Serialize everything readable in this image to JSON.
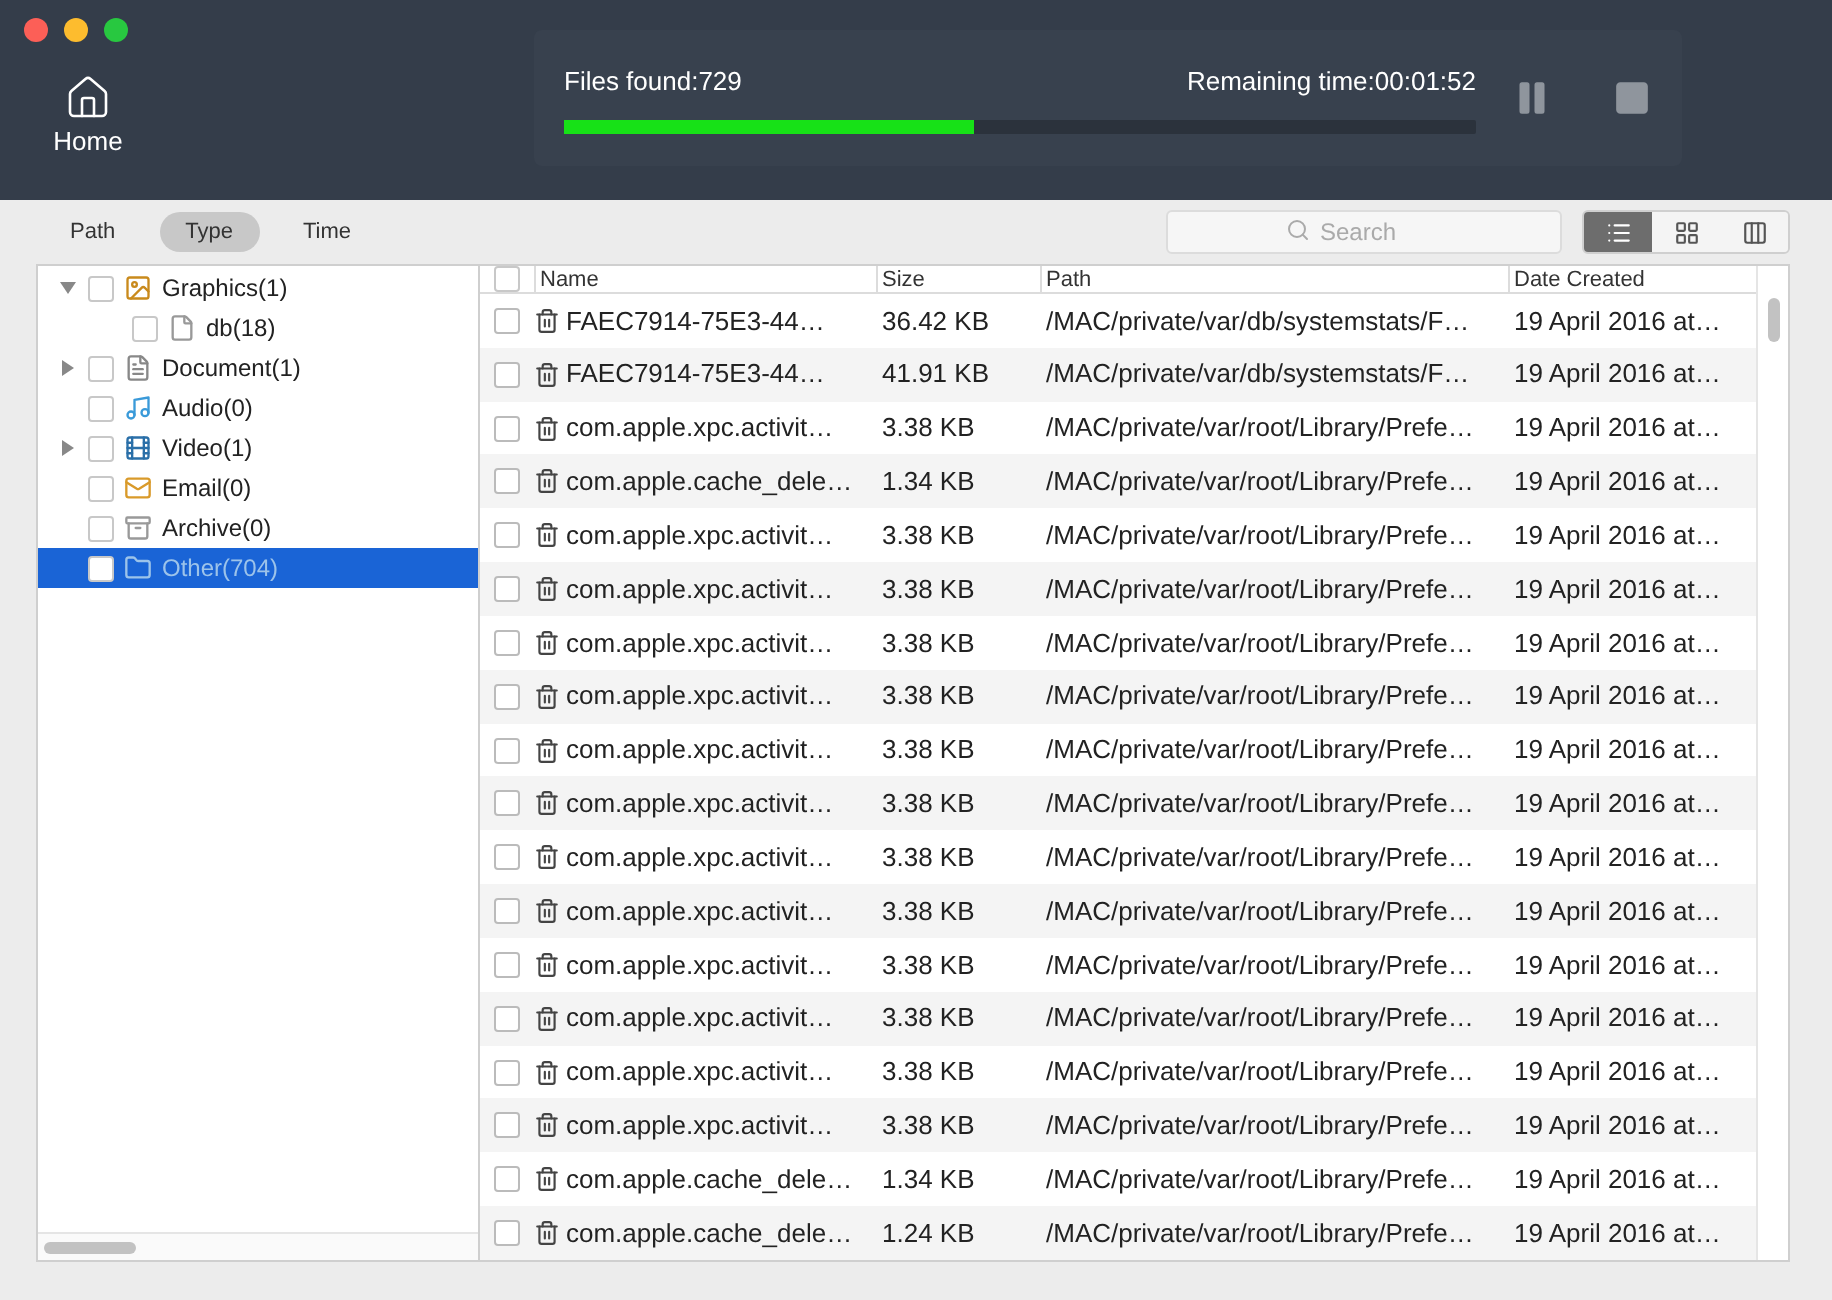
{
  "home": {
    "label": "Home"
  },
  "scan": {
    "files_found": "Files found:729",
    "remaining": "Remaining time:00:01:52",
    "level": 0.45
  },
  "tabs": [
    {
      "label": "Path",
      "selected": false
    },
    {
      "label": "Type",
      "selected": true
    },
    {
      "label": "Time",
      "selected": false
    }
  ],
  "search": {
    "placeholder": "Search"
  },
  "views": [
    {
      "selected": true
    },
    {
      "selected": false
    },
    {
      "selected": false
    }
  ],
  "tree": [
    {
      "kind": "group",
      "label": "Graphics(1)",
      "checked": false,
      "selected": false,
      "expanded": true,
      "children": [
        {
          "label": "db(18)",
          "checked": false,
          "selected": false
        }
      ]
    },
    {
      "kind": "group",
      "label": "Document(1)",
      "checked": false,
      "selected": false,
      "expanded": false
    },
    {
      "kind": "leaf",
      "label": "Audio(0)",
      "checked": false,
      "selected": false
    },
    {
      "kind": "group",
      "label": "Video(1)",
      "checked": false,
      "selected": false,
      "expanded": false
    },
    {
      "kind": "leaf",
      "label": "Email(0)",
      "checked": false,
      "selected": false
    },
    {
      "kind": "leaf",
      "label": "Archive(0)",
      "checked": false,
      "selected": false
    },
    {
      "kind": "leaf",
      "label": "Other(704)",
      "checked": false,
      "selected": true
    }
  ],
  "table": {
    "all_checked": false,
    "columns": [
      "Name",
      "Size",
      "Path",
      "Date Created"
    ],
    "rows": [
      {
        "checked": false,
        "cells": [
          "FAEC7914-75E3-44…",
          "36.42 KB",
          "/MAC/private/var/db/systemstats/F…",
          "19 April 2016 at…"
        ]
      },
      {
        "checked": false,
        "cells": [
          "FAEC7914-75E3-44…",
          "41.91 KB",
          "/MAC/private/var/db/systemstats/F…",
          "19 April 2016 at…"
        ]
      },
      {
        "checked": false,
        "cells": [
          "com.apple.xpc.activit…",
          "3.38 KB",
          "/MAC/private/var/root/Library/Prefe…",
          "19 April 2016 at…"
        ]
      },
      {
        "checked": false,
        "cells": [
          "com.apple.cache_dele…",
          "1.34 KB",
          "/MAC/private/var/root/Library/Prefe…",
          "19 April 2016 at…"
        ]
      },
      {
        "checked": false,
        "cells": [
          "com.apple.xpc.activit…",
          "3.38 KB",
          "/MAC/private/var/root/Library/Prefe…",
          "19 April 2016 at…"
        ]
      },
      {
        "checked": false,
        "cells": [
          "com.apple.xpc.activit…",
          "3.38 KB",
          "/MAC/private/var/root/Library/Prefe…",
          "19 April 2016 at…"
        ]
      },
      {
        "checked": false,
        "cells": [
          "com.apple.xpc.activit…",
          "3.38 KB",
          "/MAC/private/var/root/Library/Prefe…",
          "19 April 2016 at…"
        ]
      },
      {
        "checked": false,
        "cells": [
          "com.apple.xpc.activit…",
          "3.38 KB",
          "/MAC/private/var/root/Library/Prefe…",
          "19 April 2016 at…"
        ]
      },
      {
        "checked": false,
        "cells": [
          "com.apple.xpc.activit…",
          "3.38 KB",
          "/MAC/private/var/root/Library/Prefe…",
          "19 April 2016 at…"
        ]
      },
      {
        "checked": false,
        "cells": [
          "com.apple.xpc.activit…",
          "3.38 KB",
          "/MAC/private/var/root/Library/Prefe…",
          "19 April 2016 at…"
        ]
      },
      {
        "checked": false,
        "cells": [
          "com.apple.xpc.activit…",
          "3.38 KB",
          "/MAC/private/var/root/Library/Prefe…",
          "19 April 2016 at…"
        ]
      },
      {
        "checked": false,
        "cells": [
          "com.apple.xpc.activit…",
          "3.38 KB",
          "/MAC/private/var/root/Library/Prefe…",
          "19 April 2016 at…"
        ]
      },
      {
        "checked": false,
        "cells": [
          "com.apple.xpc.activit…",
          "3.38 KB",
          "/MAC/private/var/root/Library/Prefe…",
          "19 April 2016 at…"
        ]
      },
      {
        "checked": false,
        "cells": [
          "com.apple.xpc.activit…",
          "3.38 KB",
          "/MAC/private/var/root/Library/Prefe…",
          "19 April 2016 at…"
        ]
      },
      {
        "checked": false,
        "cells": [
          "com.apple.xpc.activit…",
          "3.38 KB",
          "/MAC/private/var/root/Library/Prefe…",
          "19 April 2016 at…"
        ]
      },
      {
        "checked": false,
        "cells": [
          "com.apple.xpc.activit…",
          "3.38 KB",
          "/MAC/private/var/root/Library/Prefe…",
          "19 April 2016 at…"
        ]
      },
      {
        "checked": false,
        "cells": [
          "com.apple.cache_dele…",
          "1.34 KB",
          "/MAC/private/var/root/Library/Prefe…",
          "19 April 2016 at…"
        ]
      },
      {
        "checked": false,
        "cells": [
          "com.apple.cache_dele…",
          "1.24 KB",
          "/MAC/private/var/root/Library/Prefe…",
          "19 April 2016 at…"
        ]
      }
    ]
  }
}
